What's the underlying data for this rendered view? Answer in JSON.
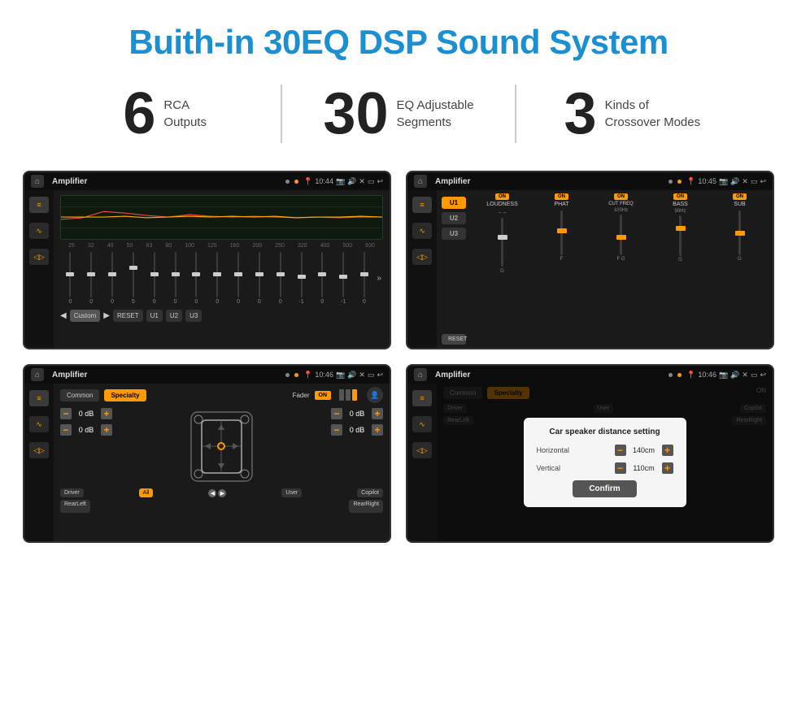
{
  "header": {
    "title": "Buith-in 30EQ DSP Sound System"
  },
  "stats": [
    {
      "number": "6",
      "label": "RCA\nOutputs"
    },
    {
      "number": "30",
      "label": "EQ Adjustable\nSegments"
    },
    {
      "number": "3",
      "label": "Kinds of\nCrossover Modes"
    }
  ],
  "screens": [
    {
      "id": "screen-eq",
      "title": "Amplifier",
      "time": "10:44",
      "type": "eq"
    },
    {
      "id": "screen-amp",
      "title": "Amplifier",
      "time": "10:45",
      "type": "amplifier"
    },
    {
      "id": "screen-fader",
      "title": "Amplifier",
      "time": "10:46",
      "type": "fader"
    },
    {
      "id": "screen-dialog",
      "title": "Amplifier",
      "time": "10:46",
      "type": "dialog"
    }
  ],
  "eq": {
    "freqs": [
      "25",
      "32",
      "40",
      "50",
      "63",
      "80",
      "100",
      "125",
      "160",
      "200",
      "250",
      "320",
      "400",
      "500",
      "630"
    ],
    "values": [
      "0",
      "0",
      "0",
      "5",
      "0",
      "0",
      "0",
      "0",
      "0",
      "0",
      "0",
      "-1",
      "0",
      "-1",
      ""
    ],
    "modes": [
      "Custom",
      "RESET",
      "U1",
      "U2",
      "U3"
    ],
    "preset": "Custom"
  },
  "amplifier": {
    "presets": [
      "U1",
      "U2",
      "U3"
    ],
    "channels": [
      "LOUDNESS",
      "PHAT",
      "CUT FREQ",
      "BASS",
      "SUB"
    ],
    "reset": "RESET"
  },
  "fader": {
    "tabs": [
      "Common",
      "Specialty"
    ],
    "active_tab": "Specialty",
    "fader_label": "Fader",
    "fader_on": "ON",
    "db_values": [
      "0 dB",
      "0 dB",
      "0 dB",
      "0 dB"
    ],
    "bottom_labels": [
      "Driver",
      "All",
      "User",
      "Copilot",
      "RearLeft",
      "RearRight"
    ]
  },
  "dialog": {
    "title": "Car speaker distance setting",
    "horizontal_label": "Horizontal",
    "horizontal_value": "140cm",
    "vertical_label": "Vertical",
    "vertical_value": "110cm",
    "confirm_label": "Confirm",
    "tabs": [
      "Common",
      "Specialty"
    ],
    "active_tab": "Specialty",
    "bottom_labels": [
      "Driver",
      "User",
      "Copilot",
      "RearLeft",
      "RearRight"
    ]
  }
}
